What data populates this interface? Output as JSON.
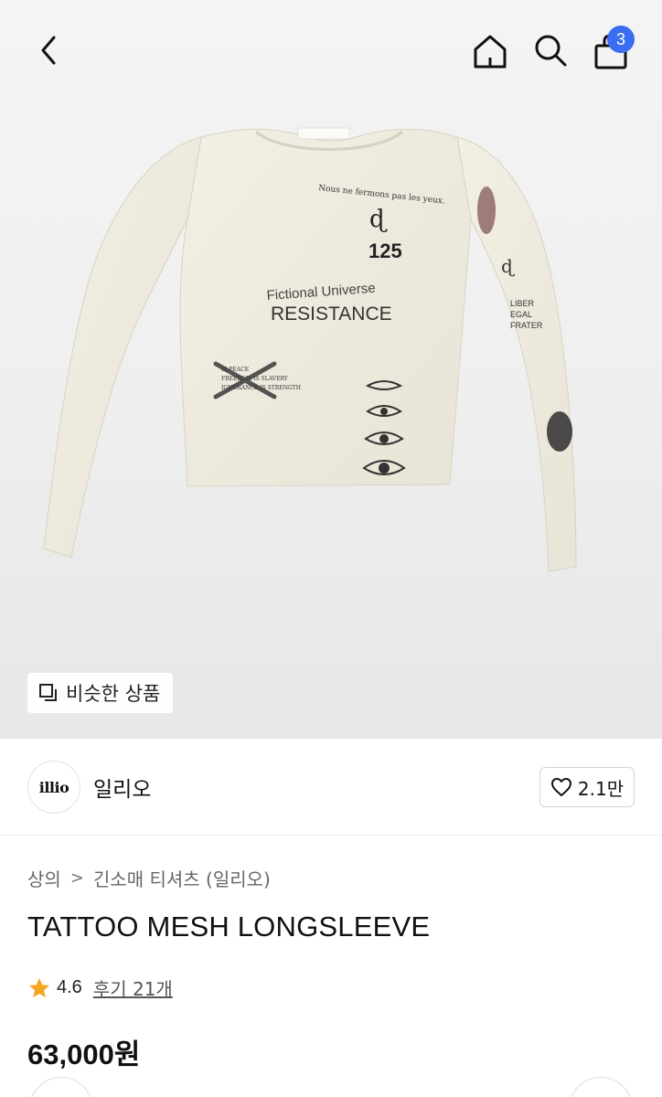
{
  "header": {
    "back_icon": "chevron-left-icon",
    "home_icon": "home-icon",
    "search_icon": "search-icon",
    "cart_icon": "shopping-bag-icon",
    "cart_count": "3",
    "badge_color": "#3a6df0"
  },
  "product_image": {
    "print_text": {
      "french_line": "Nous ne fermons pas les yeux.",
      "number": "125",
      "fiction_line": "Fictional Universe",
      "resistance": "RESISTANCE",
      "crossed_lines": [
        "IS PEACE",
        "FREEDOM IS SLAVERY",
        "IGNORANCE IS STRENGTH"
      ],
      "sleeve_words": [
        "LIBER",
        "EGAL",
        "FRATER"
      ]
    }
  },
  "similar_button": {
    "icon": "copy-icon",
    "label": "비슷한 상품"
  },
  "brand": {
    "logo_text": "illio",
    "name": "일리오",
    "like_icon": "heart-icon",
    "like_count": "2.1만"
  },
  "breadcrumb": {
    "items": [
      "상의",
      "긴소매 티셔츠 (일리오)"
    ],
    "separator": ">"
  },
  "product": {
    "title": "TATTOO MESH LONGSLEEVE",
    "rating": "4.6",
    "star_color": "#f5a623",
    "review_text": "후기 21개",
    "price": "63,000원"
  }
}
